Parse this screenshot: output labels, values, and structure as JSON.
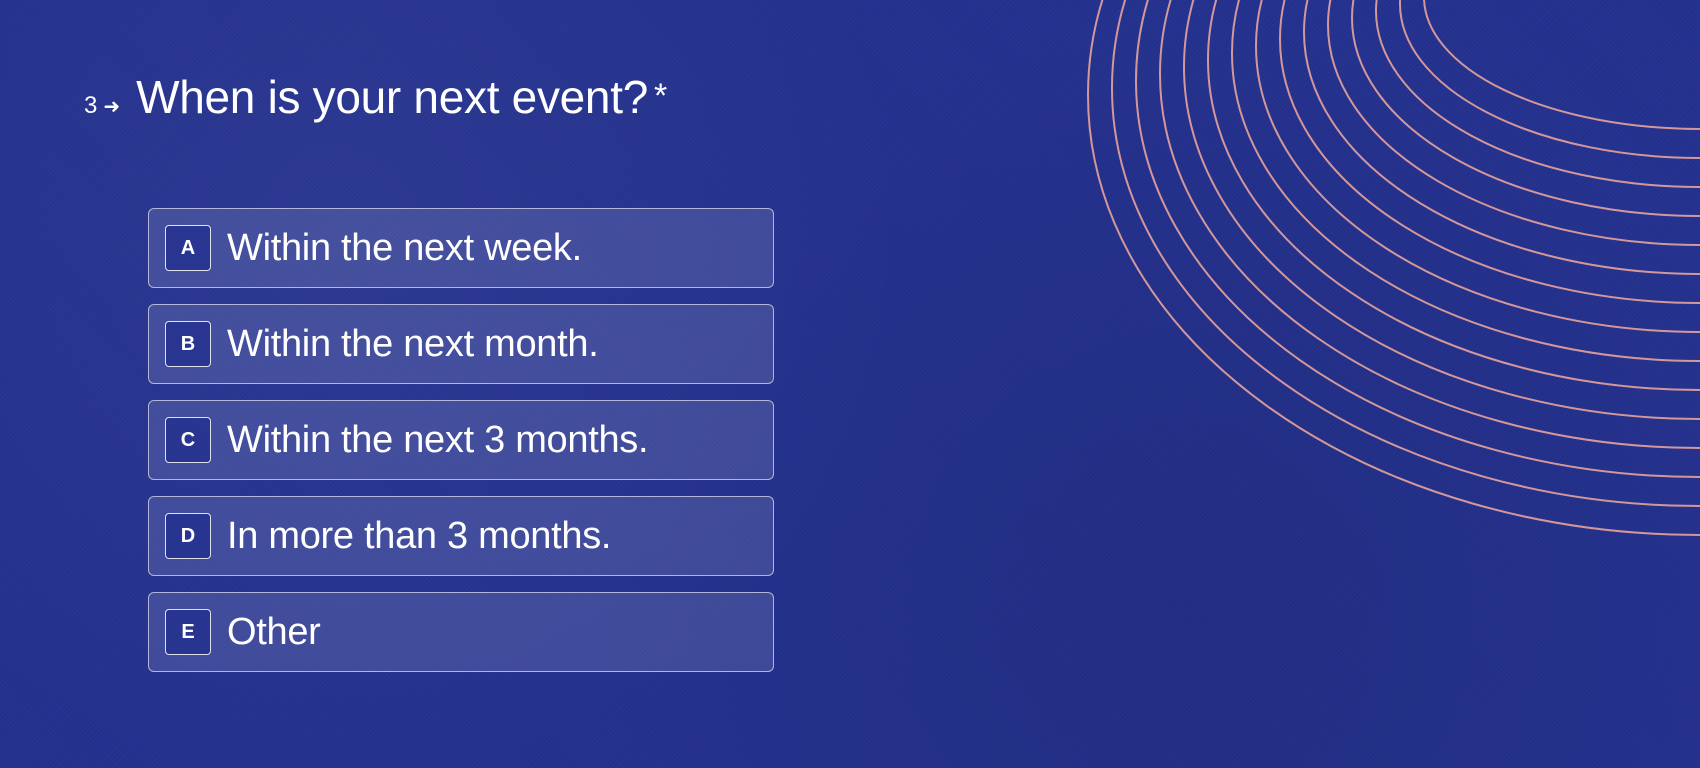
{
  "colors": {
    "background": "#24318e",
    "arcs": "#e7a39c",
    "text": "#ffffff"
  },
  "question": {
    "number": "3",
    "arrow_icon": "right-arrow-icon",
    "title": "When is your next event?",
    "required_mark": "*"
  },
  "choices": [
    {
      "key": "A",
      "label": "Within the next week."
    },
    {
      "key": "B",
      "label": "Within the next month."
    },
    {
      "key": "C",
      "label": "Within the next 3 months."
    },
    {
      "key": "D",
      "label": "In more than 3 months."
    },
    {
      "key": "E",
      "label": "Other"
    }
  ]
}
